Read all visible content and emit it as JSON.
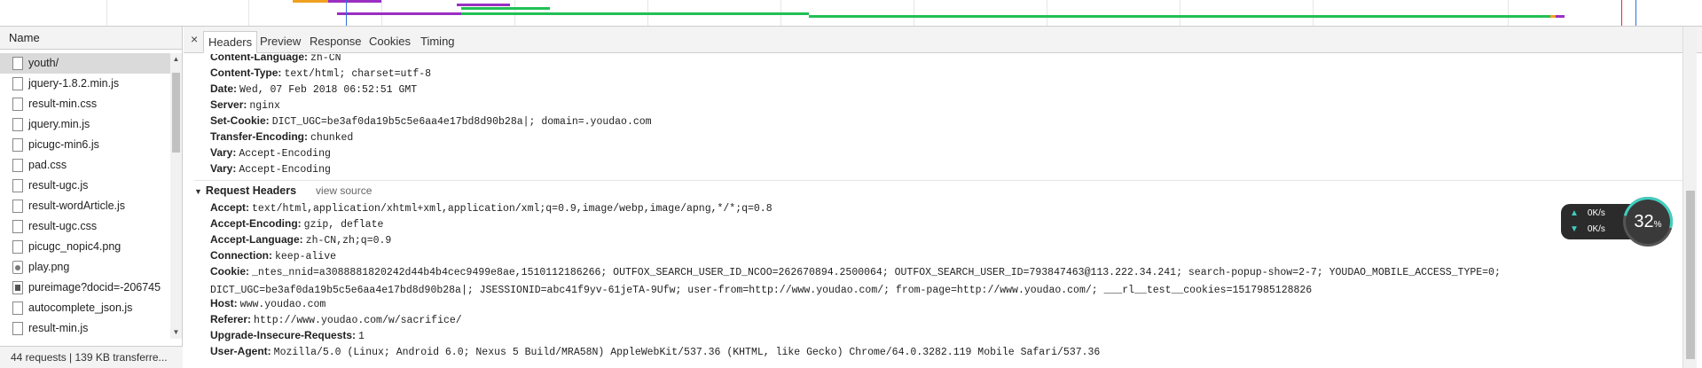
{
  "sidebar": {
    "header": "Name",
    "items": [
      {
        "label": "youth/",
        "icon": "document-icon"
      },
      {
        "label": "jquery-1.8.2.min.js",
        "icon": "document-icon"
      },
      {
        "label": "result-min.css",
        "icon": "document-icon"
      },
      {
        "label": "jquery.min.js",
        "icon": "document-icon"
      },
      {
        "label": "picugc-min6.js",
        "icon": "document-icon"
      },
      {
        "label": "pad.css",
        "icon": "document-icon"
      },
      {
        "label": "result-ugc.js",
        "icon": "document-icon"
      },
      {
        "label": "result-wordArticle.js",
        "icon": "document-icon"
      },
      {
        "label": "result-ugc.css",
        "icon": "document-icon"
      },
      {
        "label": "picugc_nopic4.png",
        "icon": "document-icon"
      },
      {
        "label": "play.png",
        "icon": "image-icon"
      },
      {
        "label": "pureimage?docid=-206745",
        "icon": "image-icon"
      },
      {
        "label": "autocomplete_json.js",
        "icon": "document-icon"
      },
      {
        "label": "result-min.js",
        "icon": "document-icon"
      }
    ],
    "status": "44 requests  |  139 KB transferre..."
  },
  "tabs": {
    "close": "×",
    "items": [
      "Headers",
      "Preview",
      "Response",
      "Cookies",
      "Timing"
    ],
    "active": "Headers"
  },
  "response_headers": [
    {
      "k": "Content-Language:",
      "v": "zh-CN"
    },
    {
      "k": "Content-Type:",
      "v": "text/html; charset=utf-8"
    },
    {
      "k": "Date:",
      "v": "Wed, 07 Feb 2018 06:52:51 GMT"
    },
    {
      "k": "Server:",
      "v": "nginx"
    },
    {
      "k": "Set-Cookie:",
      "v": "DICT_UGC=be3af0da19b5c5e6aa4e17bd8d90b28a|; domain=.youdao.com"
    },
    {
      "k": "Transfer-Encoding:",
      "v": "chunked"
    },
    {
      "k": "Vary:",
      "v": "Accept-Encoding"
    },
    {
      "k": "Vary:",
      "v": "Accept-Encoding"
    }
  ],
  "request_section": {
    "title": "Request Headers",
    "view_source": "view source"
  },
  "request_headers": [
    {
      "k": "Accept:",
      "v": "text/html,application/xhtml+xml,application/xml;q=0.9,image/webp,image/apng,*/*;q=0.8"
    },
    {
      "k": "Accept-Encoding:",
      "v": "gzip, deflate"
    },
    {
      "k": "Accept-Language:",
      "v": "zh-CN,zh;q=0.9"
    },
    {
      "k": "Connection:",
      "v": "keep-alive"
    },
    {
      "k": "Cookie:",
      "v": "_ntes_nnid=a3088881820242d44b4b4cec9499e8ae,1510112186266; OUTFOX_SEARCH_USER_ID_NCOO=262670894.2500064; OUTFOX_SEARCH_USER_ID=793847463@113.222.34.241; search-popup-show=2-7; YOUDAO_MOBILE_ACCESS_TYPE=0; DICT_UGC=be3af0da19b5c5e6aa4e17bd8d90b28a|; JSESSIONID=abc41f9yv-61jeTA-9Ufw; user-from=http://www.youdao.com/; from-page=http://www.youdao.com/; ___rl__test__cookies=1517985128826"
    },
    {
      "k": "Host:",
      "v": "www.youdao.com"
    },
    {
      "k": "Referer:",
      "v": "http://www.youdao.com/w/sacrifice/"
    },
    {
      "k": "Upgrade-Insecure-Requests:",
      "v": "1"
    },
    {
      "k": "User-Agent:",
      "v": "Mozilla/5.0 (Linux; Android 6.0; Nexus 5 Build/MRA58N) AppleWebKit/537.36 (KHTML, like Gecko) Chrome/64.0.3282.119 Mobile Safari/537.36"
    }
  ],
  "widget": {
    "up": "0K/s",
    "down": "0K/s",
    "percent": "32",
    "percent_unit": "%"
  },
  "colors": {
    "accent_teal": "#3fd0c0",
    "bar_green": "#22c055",
    "bar_purple": "#9a2fc2",
    "bar_orange": "#f0a020",
    "bar_blue": "#2f6fe0"
  }
}
